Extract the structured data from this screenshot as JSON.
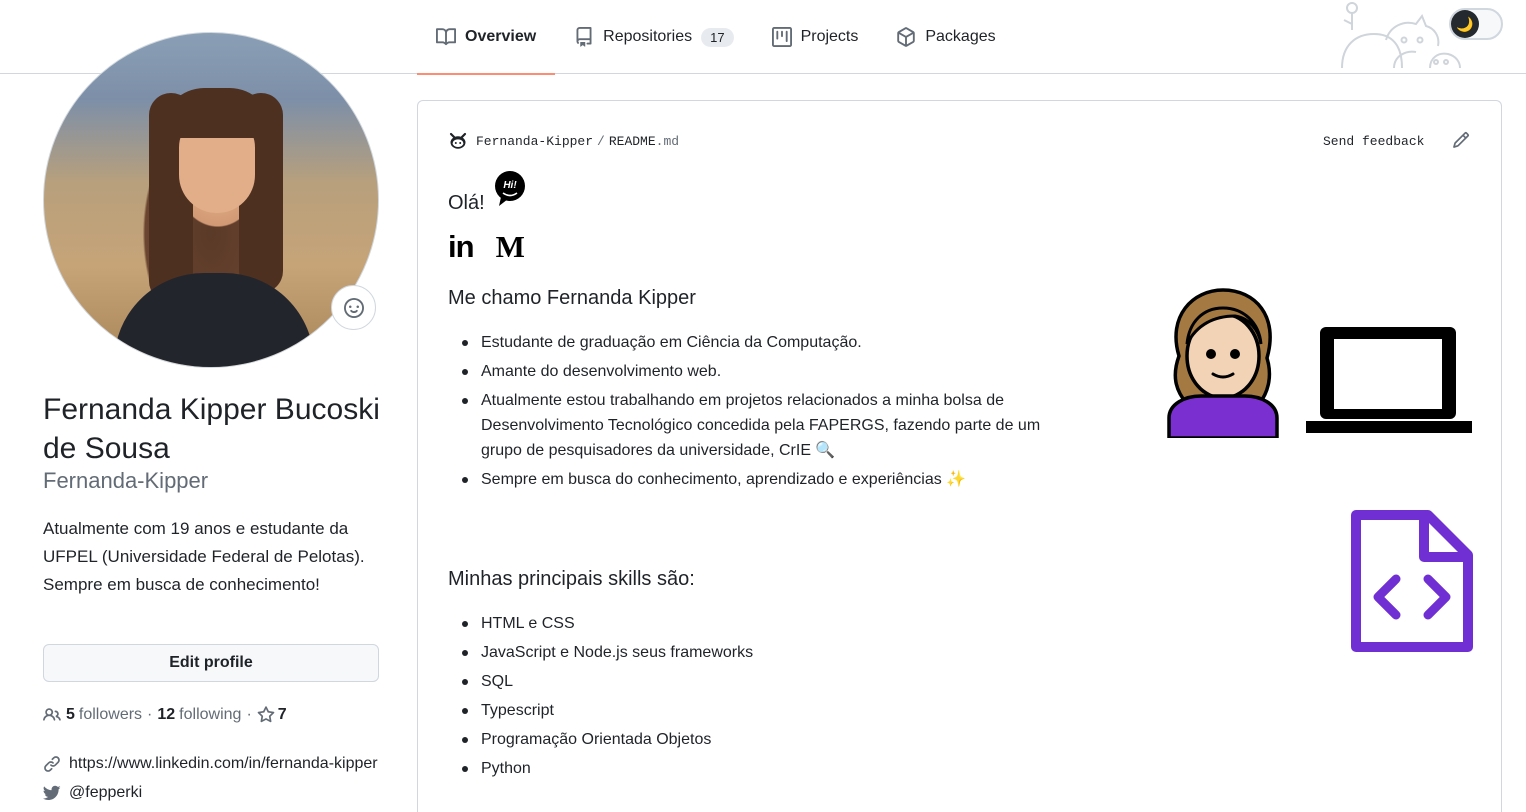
{
  "tabs": [
    {
      "label": "Overview",
      "icon": "book-icon",
      "active": true
    },
    {
      "label": "Repositories",
      "icon": "repo-icon",
      "count": "17"
    },
    {
      "label": "Projects",
      "icon": "project-icon"
    },
    {
      "label": "Packages",
      "icon": "package-icon"
    }
  ],
  "theme_toggle": {
    "icon": "moon-icon",
    "glyph": "🌙"
  },
  "profile": {
    "fullname": "Fernanda Kipper Bucoski de Sousa",
    "username": "Fernanda-Kipper",
    "bio": "Atualmente com 19 anos e estudante da UFPEL (Universidade Federal de Pelotas). Sempre em busca de conhecimento!",
    "edit_label": "Edit profile",
    "followers_count": "5",
    "followers_label": "followers",
    "following_count": "12",
    "following_label": "following",
    "stars_count": "7",
    "linkedin_url": "https://www.linkedin.com/in/fernanda-kipper",
    "twitter": "@fepperki"
  },
  "readme": {
    "owner": "Fernanda-Kipper",
    "separator": "/",
    "file_name": "README",
    "file_ext": ".md",
    "feedback": "Send feedback",
    "greeting": "Olá!",
    "greeting_badge": "Hi!",
    "social_linkedin": "in",
    "social_medium": "M",
    "heading1": "Me chamo Fernanda Kipper",
    "about": [
      "Estudante de graduação em Ciência da Computação.",
      "Amante do desenvolvimento web.",
      "Atualmente estou trabalhando em projetos relacionados a minha bolsa de Desenvolvimento Tecnológico concedida pela FAPERGS, fazendo parte de um grupo de pesquisadores da universidade, CrIE 🔍",
      "Sempre em busca do conhecimento, aprendizado e experiências ✨"
    ],
    "heading2": "Minhas principais skills são:",
    "skills": [
      "HTML e CSS",
      "JavaScript e Node.js seus frameworks",
      "SQL",
      "Typescript",
      "Programação Orientada Objetos",
      "Python"
    ]
  },
  "colors": {
    "accent_tab": "#fd8c73",
    "purple": "#6f2fd3",
    "text": "#1f2328",
    "muted": "#636c76"
  }
}
